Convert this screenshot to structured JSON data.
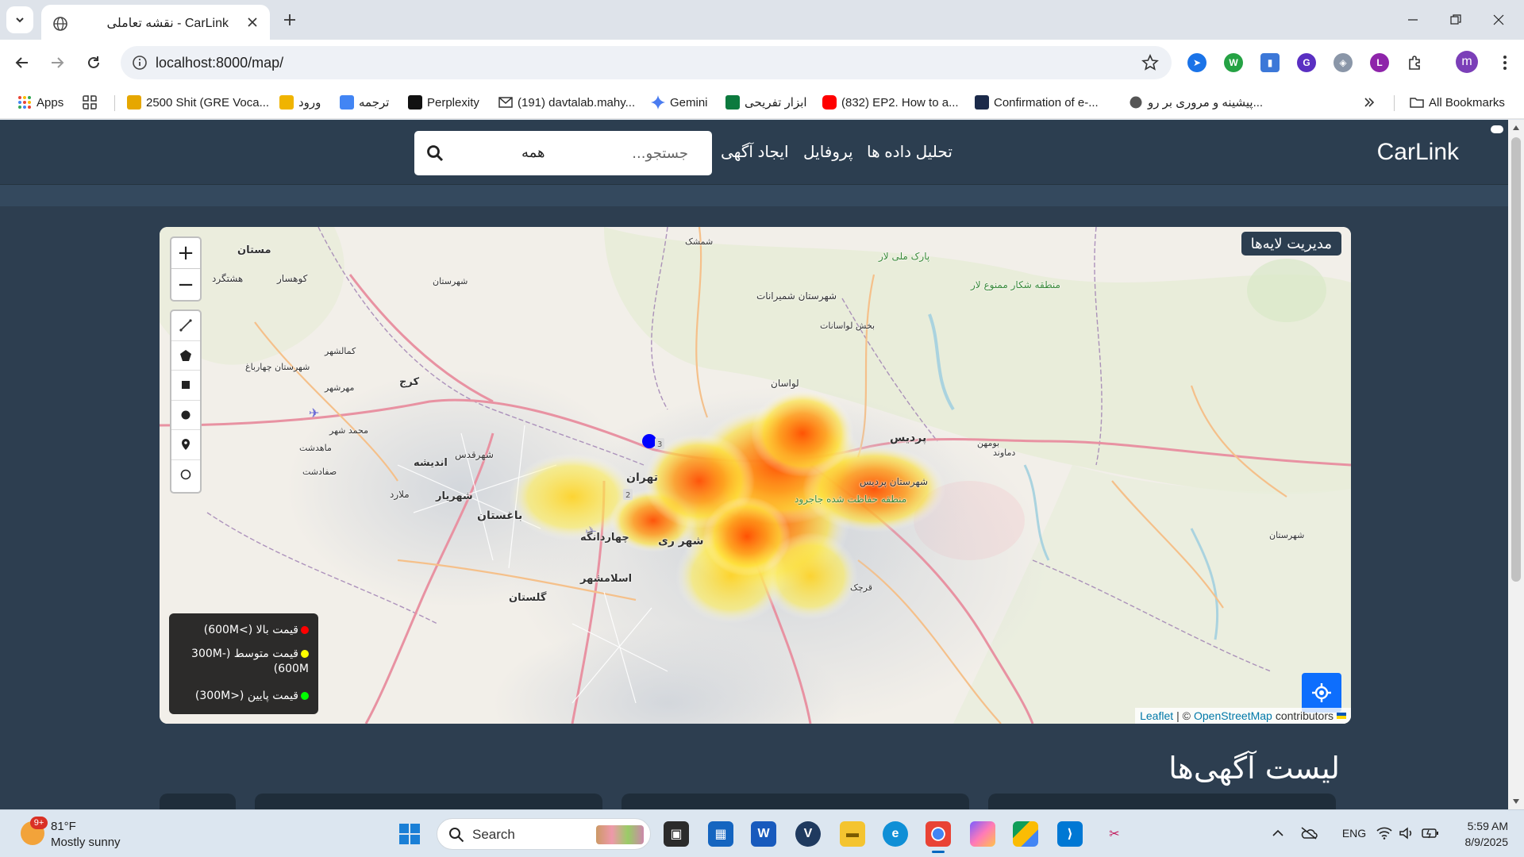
{
  "browser": {
    "tab_title": "CarLink - نقشه تعاملی",
    "url": "localhost:8000/map/",
    "bookmarks": [
      {
        "label": "Apps"
      },
      {
        "label": "2500 Shit (GRE Voca..."
      },
      {
        "label": "ورود"
      },
      {
        "label": "ترجمه"
      },
      {
        "label": "Perplexity"
      },
      {
        "label": "(191) davtalab.mahy..."
      },
      {
        "label": "Gemini"
      },
      {
        "label": "ابزار تفریحی"
      },
      {
        "label": "(832) EP2. How to a..."
      },
      {
        "label": "Confirmation of e-..."
      },
      {
        "label": "پیشینه و مروری بر رو..."
      }
    ],
    "all_bookmarks": "All Bookmarks",
    "profile_initial": "m"
  },
  "site": {
    "brand": "CarLink",
    "nav": {
      "analytics": "تحلیل داده ها",
      "profile": "پروفایل",
      "create_ad": "ایجاد آگهی"
    },
    "search": {
      "placeholder": "جستجو...",
      "filter_value": "همه"
    }
  },
  "map": {
    "layers_button": "مدیریت لایه‌ها",
    "zoom_in": "+",
    "zoom_out": "−",
    "draw_tools": [
      "polyline-tool",
      "polygon-tool",
      "rectangle-tool",
      "circle-tool",
      "marker-tool",
      "circlemarker-tool"
    ],
    "legend": [
      {
        "label": "قیمت بالا (>600M)",
        "color": "#ff0000"
      },
      {
        "label": "قیمت متوسط (300M-600M)",
        "color": "#ffff00"
      },
      {
        "label": "قیمت پایین (<300M)",
        "color": "#00ff00"
      }
    ],
    "attribution": {
      "leaflet": "Leaflet",
      "separator": "| ©",
      "osm": "OpenStreetMap",
      "suffix": "contributors"
    },
    "place_labels": [
      "مستان",
      "هشتگرد",
      "کوهسار",
      "کرج",
      "کمالشهر",
      "شهرستان چهارباغ",
      "مهرشهر",
      "محمد شهر",
      "ماهدشت",
      "شهریار",
      "اندیشه",
      "ملارد",
      "صفادشت",
      "شهرقدس",
      "باغستان",
      "چهاردانگه",
      "اسلامشهر",
      "گلستان",
      "شهر ری",
      "تهران",
      "لواسان",
      "پردیس",
      "بومهن",
      "دماوند",
      "شمشک",
      "شهرستان شمیرانات",
      "منطقه حفاظت شده جاجرود",
      "شهرستان پردیس",
      "شهرستان",
      "بخش لواسانات",
      "منطقه شکار ممنوع لار",
      "پارک ملی لار",
      "شهرستان",
      "قرچک"
    ],
    "marker_color": "#0000ff",
    "heat_colors": [
      "#ffee44",
      "#ff9a1a",
      "#ff4d00"
    ]
  },
  "listings": {
    "title": "لیست آگهی‌ها"
  },
  "taskbar": {
    "weather_badge": "9+",
    "temperature": "81°F",
    "condition": "Mostly sunny",
    "search_label": "Search",
    "language": "ENG",
    "time": "5:59 AM",
    "date": "8/9/2025"
  }
}
